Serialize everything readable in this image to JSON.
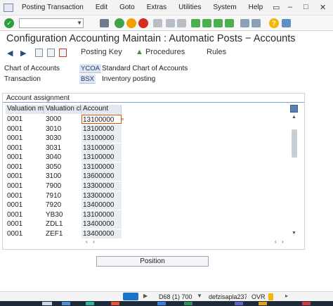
{
  "menu": [
    "Posting Transaction",
    "Edit",
    "Goto",
    "Extras",
    "Utilities",
    "System",
    "Help"
  ],
  "title": "Configuration Accounting Maintain : Automatic Posts − Accounts",
  "app_toolbar": {
    "posting_key": "Posting Key",
    "procedures": "Procedures",
    "rules": "Rules"
  },
  "header": {
    "chart_label": "Chart of Accounts",
    "chart_value": "YCOA",
    "chart_desc": "Standard Chart of Accounts",
    "trans_label": "Transaction",
    "trans_value": "BSX",
    "trans_desc": "Inventory posting"
  },
  "group_title": "Account assignment",
  "columns": [
    "Valuation mo",
    "Valuation cla",
    "Account"
  ],
  "rows": [
    [
      "0001",
      "3000",
      "13100000"
    ],
    [
      "0001",
      "3010",
      "13100000"
    ],
    [
      "0001",
      "3030",
      "13100000"
    ],
    [
      "0001",
      "3031",
      "13100000"
    ],
    [
      "0001",
      "3040",
      "13100000"
    ],
    [
      "0001",
      "3050",
      "13100000"
    ],
    [
      "0001",
      "3100",
      "13600000"
    ],
    [
      "0001",
      "7900",
      "13300000"
    ],
    [
      "0001",
      "7910",
      "13300000"
    ],
    [
      "0001",
      "7920",
      "13400000"
    ],
    [
      "0001",
      "YB30",
      "13100000"
    ],
    [
      "0001",
      "ZDL1",
      "13400000"
    ],
    [
      "0001",
      "ZEF1",
      "13400000"
    ]
  ],
  "position_button": "Position",
  "status": {
    "system": "D68 (1) 700",
    "server": "defzisapla237",
    "mode": "OVR"
  },
  "colors": {
    "accent_blue": "#7ea3cf",
    "value_bg": "#dde6f2",
    "ok_green": "#2a9d3c",
    "nav_green": "#3fa34d",
    "nav_orange": "#f0a000",
    "cancel_red": "#d62d20",
    "help_yellow": "#f2b705"
  }
}
